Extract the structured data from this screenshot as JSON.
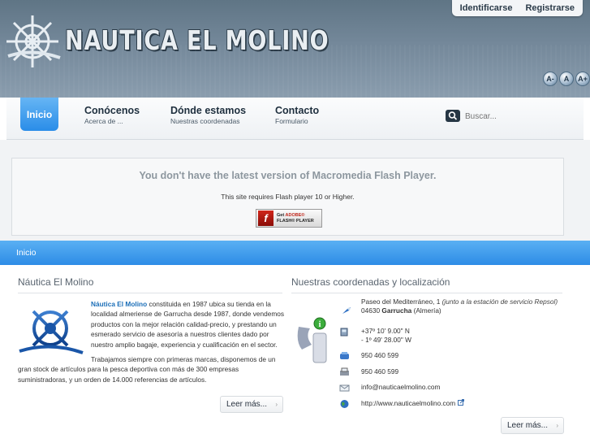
{
  "header": {
    "logo_text": "NAUTICA EL MOLINO",
    "user_links": [
      "Identificarse",
      "Registrarse"
    ],
    "font_buttons": [
      "A-",
      "A",
      "A+"
    ]
  },
  "nav": {
    "home": "Inicio",
    "items": [
      {
        "title": "Conócenos",
        "sub": "Acerca de ..."
      },
      {
        "title": "Dónde estamos",
        "sub": "Nuestras coordenadas"
      },
      {
        "title": "Contacto",
        "sub": "Formulario"
      }
    ],
    "search_placeholder": "Buscar..."
  },
  "flash": {
    "title": "You don't have the latest version of Macromedia Flash Player.",
    "subtitle": "This site requires Flash player 10 or Higher.",
    "badge_line1": "Get",
    "badge_brand": "ADOBE®",
    "badge_line2": "FLASH® PLAYER"
  },
  "breadcrumb": "Inicio",
  "left": {
    "title": "Náutica El Molino",
    "brand": "Náutica El Molino",
    "p1_rest": " constituida en 1987 ubica su tienda en la localidad almeriense de Garrucha desde 1987, donde vendemos productos con la mejor relación calidad-precio, y prestando un esmerado servicio de asesoría a nuestros clientes dado por nuestro amplio bagaje, experiencia y cualificación en el sector.",
    "p2": "Trabajamos siempre con primeras marcas, disponemos de un gran stock de artículos para la pesca deportiva con más de 300 empresas suministradoras, y un orden de 14.000 referencias de artículos.",
    "read_more": "Leer más..."
  },
  "right": {
    "title": "Nuestras coordenadas y localización",
    "address_line1": "Paseo del Mediterráneo, 1 ",
    "address_note": "(junto a la estación de servicio Repsol)",
    "address_line2_pre": "04630 ",
    "address_city": "Garrucha",
    "address_region": " (Almería)",
    "gps_lat": "+37º 10' 9.00\" N",
    "gps_lon": "- 1º 49' 28.00\" W",
    "phone": "950 460 599",
    "fax": "950 460 599",
    "email": "info@nauticaelmolino.com",
    "web": "http://www.nauticaelmolino.com",
    "read_more": "Leer más..."
  },
  "colors": {
    "accent_blue": "#2d8ce6",
    "header_bg": "#74889a",
    "link_blue": "#1c6fb8"
  }
}
